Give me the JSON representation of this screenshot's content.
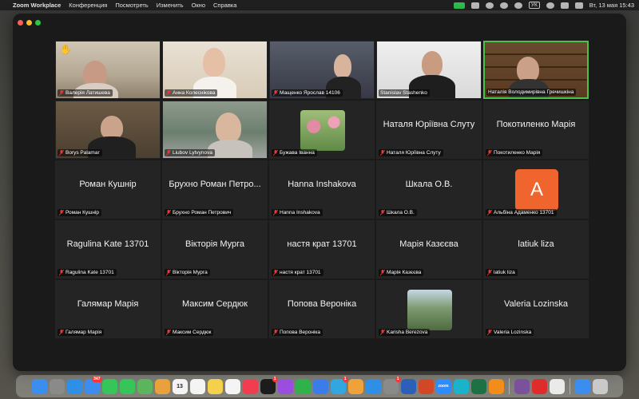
{
  "menubar": {
    "app_name": "Zoom Workplace",
    "menus": [
      "Конференция",
      "Посмотреть",
      "Изменить",
      "Окно",
      "Справка"
    ],
    "keyboard_layout": "УК",
    "datetime": "Вт, 13 мая  15:43"
  },
  "tiles": [
    {
      "name": "Валерія Латишева",
      "video": "v1",
      "hand_raised": true
    },
    {
      "name": "Анна Колеснікова",
      "video": "v2"
    },
    {
      "name": "Мащенко Ярослав 14106",
      "video": "v3"
    },
    {
      "name": "Stanislav Stashenko",
      "video": "v4"
    },
    {
      "name": "Наталія Володимирівна Гречишкіна",
      "video": "v5",
      "active": true
    },
    {
      "name": "Borys Palamar",
      "video": "v6"
    },
    {
      "name": "Liubov Lytvynova",
      "video": "v7"
    },
    {
      "name": "Бужава Іванна",
      "thumb": "flowers"
    },
    {
      "name": "Наталя Юріївна Слуту",
      "display": "Наталя Юріївна Слуту"
    },
    {
      "name": "Покотиленко Марія",
      "display": "Покотиленко Марія"
    },
    {
      "name": "Роман Кушнір",
      "display": "Роман Кушнір"
    },
    {
      "name": "Брухно Роман Петрович",
      "display": "Брухно Роман Петро..."
    },
    {
      "name": "Hanna Inshakova",
      "display": "Hanna Inshakova"
    },
    {
      "name": "Шкала О.В.",
      "display": "Шкала О.В."
    },
    {
      "name": "Альбіна Адаменко 13701",
      "avatar": "A",
      "avatar_color": "#f0642d"
    },
    {
      "name": "Ragulina Kate 13701",
      "display": "Ragulina Kate 13701"
    },
    {
      "name": "Вікторія Мурга",
      "display": "Вікторія Мурга"
    },
    {
      "name": "настя крат 13701",
      "display": "настя крат 13701"
    },
    {
      "name": "Марія Казєєва",
      "display": "Марія Казєєва"
    },
    {
      "name": "latiuk liza",
      "display": "latiuk liza"
    },
    {
      "name": "Галямар Марія",
      "display": "Галямар Марія"
    },
    {
      "name": "Максим Сердюк",
      "display": "Максим Сердюк"
    },
    {
      "name": "Попова Вероніка",
      "display": "Попова Вероніка"
    },
    {
      "name": "Karisha Berezova",
      "thumb": "tree"
    },
    {
      "name": "Valeria Lozinska",
      "display": "Valeria Lozinska"
    }
  ],
  "dock": {
    "apps": [
      {
        "name": "finder-icon",
        "color": "#3b8ef0"
      },
      {
        "name": "launchpad-icon",
        "color": "#8a8a8a"
      },
      {
        "name": "safari-icon",
        "color": "#2f8fe6"
      },
      {
        "name": "mail-icon",
        "color": "#3d8cf0",
        "badge": "347"
      },
      {
        "name": "facetime-icon",
        "color": "#35c559"
      },
      {
        "name": "messages-icon",
        "color": "#35c559"
      },
      {
        "name": "maps-icon",
        "color": "#5bb55c"
      },
      {
        "name": "photos-icon",
        "color": "#e9a23b"
      },
      {
        "name": "calendar-icon",
        "color": "#f4f4f4",
        "text": "13"
      },
      {
        "name": "reminders-icon",
        "color": "#f4f4f4"
      },
      {
        "name": "notes-icon",
        "color": "#f5d04a"
      },
      {
        "name": "freeform-icon",
        "color": "#f4f4f4"
      },
      {
        "name": "music-icon",
        "color": "#f23c4f"
      },
      {
        "name": "tv-icon",
        "color": "#1c1c1c",
        "badge": "1"
      },
      {
        "name": "podcasts-icon",
        "color": "#9b4de0"
      },
      {
        "name": "numbers-icon",
        "color": "#2fb24b"
      },
      {
        "name": "keynote-icon",
        "color": "#3b7de8"
      },
      {
        "name": "telegram-icon",
        "color": "#31a6e0",
        "badge": "1"
      },
      {
        "name": "pages-icon",
        "color": "#f0a23a"
      },
      {
        "name": "appstore-icon",
        "color": "#2f8fe6"
      },
      {
        "name": "settings-icon",
        "color": "#8a8a8a",
        "badge": "1"
      },
      {
        "name": "word-icon",
        "color": "#2b5fb8"
      },
      {
        "name": "powerpoint-icon",
        "color": "#d24726"
      },
      {
        "name": "zoom-icon",
        "color": "#2d8cff",
        "text": "zoom"
      },
      {
        "name": "canva-icon",
        "color": "#19b4c9"
      },
      {
        "name": "excel-icon",
        "color": "#1e7145"
      },
      {
        "name": "vlc-icon",
        "color": "#f28c1a"
      },
      {
        "name": "viber-icon",
        "color": "#7b519d"
      },
      {
        "name": "acrobat-icon",
        "color": "#e02b2b"
      },
      {
        "name": "preview-icon",
        "color": "#eaeaea"
      },
      {
        "name": "downloads-icon",
        "color": "#3b8ef0"
      },
      {
        "name": "trash-icon",
        "color": "#c9c9c9"
      }
    ]
  }
}
